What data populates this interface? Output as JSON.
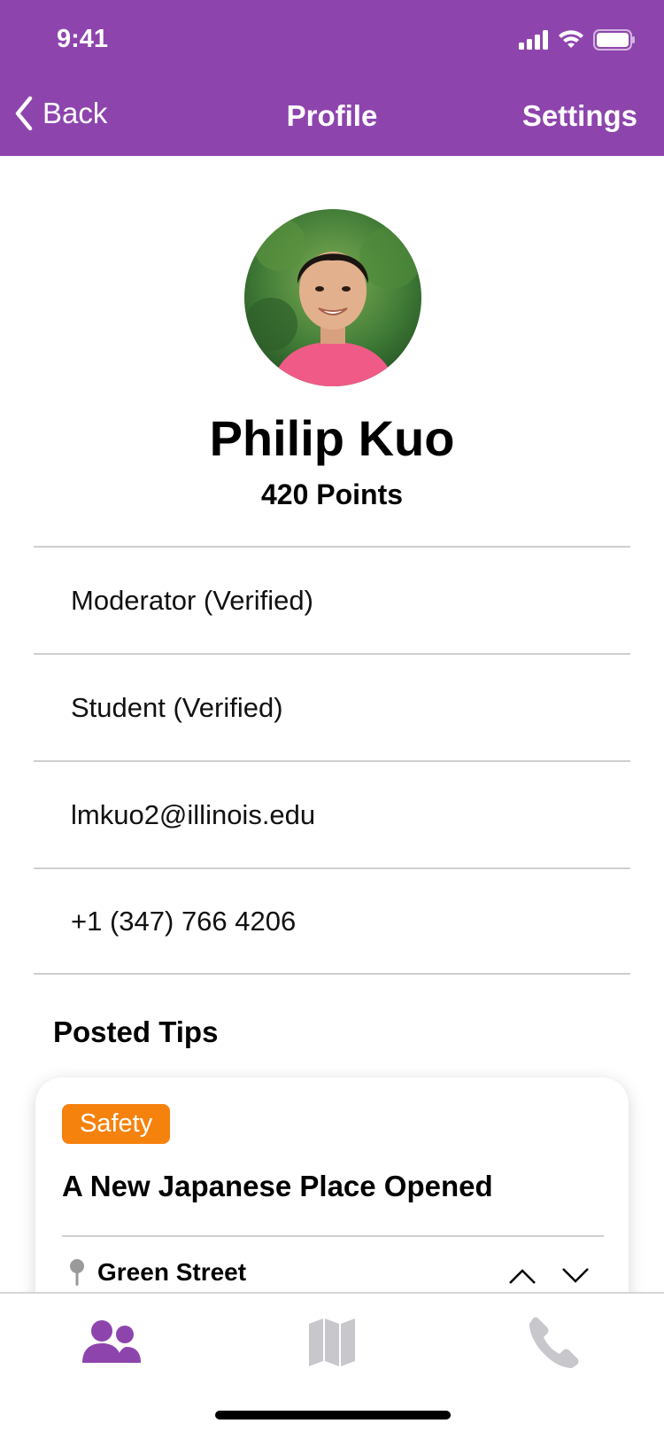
{
  "status_bar": {
    "time": "9:41"
  },
  "nav": {
    "back_label": "Back",
    "title": "Profile",
    "settings_label": "Settings"
  },
  "profile": {
    "name": "Philip Kuo",
    "points": "420 Points",
    "info": [
      "Moderator (Verified)",
      "Student (Verified)",
      "lmkuo2@illinois.edu",
      "+1 (347) 766 4206"
    ]
  },
  "posted_tips": {
    "title": "Posted Tips",
    "tips": [
      {
        "category": "Safety",
        "title": "A New Japanese Place Opened",
        "location": "Green Street"
      }
    ]
  },
  "tab_bar": {
    "tabs": [
      {
        "icon": "people-icon",
        "active": true
      },
      {
        "icon": "map-icon",
        "active": false
      },
      {
        "icon": "phone-icon",
        "active": false
      }
    ]
  },
  "colors": {
    "header": "#8E44AD",
    "active_tab": "#8E44AD",
    "inactive_tab": "#C7C7CC",
    "badge_safety": "#F5820D"
  }
}
